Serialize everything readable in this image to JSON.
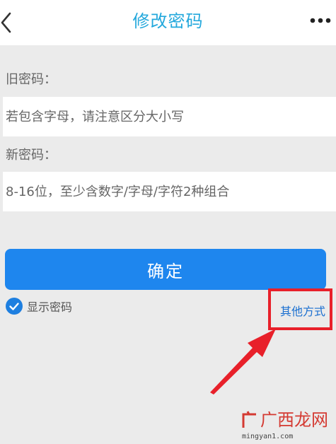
{
  "header": {
    "title": "修改密码",
    "back_icon": "chevron-left-icon",
    "more_icon": "more-horizontal-icon",
    "title_color": "#23a8dc"
  },
  "form": {
    "old_password_label": "旧密码：",
    "old_password_placeholder": "若包含字母，请注意区分大小写",
    "new_password_label": "新密码：",
    "new_password_placeholder": "8-16位，至少含数字/字母/字符2种组合",
    "confirm_label": "确定",
    "confirm_color": "#1e86ee",
    "show_password_label": "显示密码",
    "show_password_checked": true,
    "other_methods_label": "其他方式"
  },
  "annotation": {
    "highlight_color": "#e8202a",
    "arrow_icon": "red-arrow-icon"
  },
  "watermark": {
    "brand": "广西龙网",
    "domain": "mingyan1.com"
  }
}
